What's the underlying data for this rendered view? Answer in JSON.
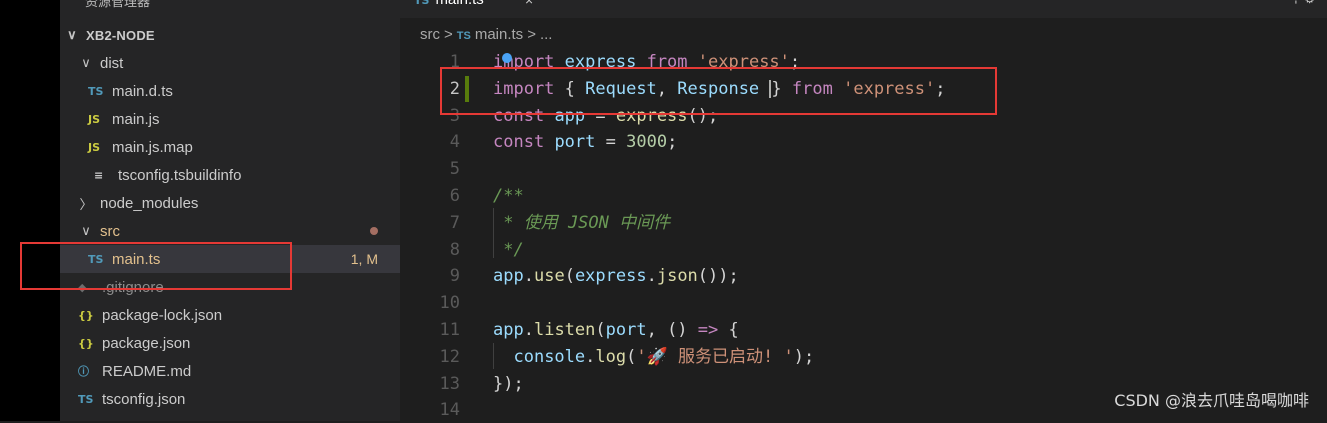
{
  "sidebar": {
    "title": "资源管理器",
    "project": "XB2-NODE",
    "tree": [
      {
        "name": "dist",
        "type": "folder",
        "expanded": true
      },
      {
        "name": "main.d.ts",
        "type": "ts"
      },
      {
        "name": "main.js",
        "type": "js"
      },
      {
        "name": "main.js.map",
        "type": "js"
      },
      {
        "name": "tsconfig.tsbuildinfo",
        "type": "lines"
      },
      {
        "name": "node_modules",
        "type": "folder",
        "expanded": false
      },
      {
        "name": "src",
        "type": "folder",
        "expanded": true
      },
      {
        "name": "main.ts",
        "type": "ts",
        "badge": "1, M"
      },
      {
        "name": ".gitignore",
        "type": "git"
      },
      {
        "name": "package-lock.json",
        "type": "json"
      },
      {
        "name": "package.json",
        "type": "json"
      },
      {
        "name": "README.md",
        "type": "info"
      },
      {
        "name": "tsconfig.json",
        "type": "tsjson"
      }
    ]
  },
  "icons": {
    "ts": "TS",
    "js": "JS",
    "json": "{}",
    "info": "ⓘ",
    "git": "◆",
    "lines": "≡",
    "chevron_down": "∨",
    "chevron_right": "〉"
  },
  "editor": {
    "tab": "main.ts",
    "tab_close": "×",
    "tab_actions": "⊹ ⚙",
    "breadcrumb": [
      "src",
      "main.ts",
      "..."
    ],
    "lines": [
      {
        "n": "1",
        "tokens": [
          [
            "kw",
            "import"
          ],
          [
            "plain",
            " "
          ],
          [
            "var",
            "express"
          ],
          [
            "plain",
            " "
          ],
          [
            "kw",
            "from"
          ],
          [
            "plain",
            " "
          ],
          [
            "str",
            "'express'"
          ],
          [
            "plain",
            ";"
          ]
        ]
      },
      {
        "n": "2",
        "tokens": [
          [
            "kw",
            "import"
          ],
          [
            "plain",
            " { "
          ],
          [
            "var",
            "Request"
          ],
          [
            "plain",
            ", "
          ],
          [
            "var",
            "Response"
          ],
          [
            "plain",
            " "
          ],
          [
            "cursor",
            ""
          ],
          [
            "plain",
            "} "
          ],
          [
            "kw",
            "from"
          ],
          [
            "plain",
            " "
          ],
          [
            "str",
            "'express'"
          ],
          [
            "plain",
            ";"
          ]
        ]
      },
      {
        "n": "3",
        "tokens": [
          [
            "kw",
            "const"
          ],
          [
            "plain",
            " "
          ],
          [
            "var",
            "app"
          ],
          [
            "plain",
            " = "
          ],
          [
            "fn",
            "express"
          ],
          [
            "plain",
            "();"
          ]
        ]
      },
      {
        "n": "4",
        "tokens": [
          [
            "kw",
            "const"
          ],
          [
            "plain",
            " "
          ],
          [
            "var",
            "port"
          ],
          [
            "plain",
            " = "
          ],
          [
            "num",
            "3000"
          ],
          [
            "plain",
            ";"
          ]
        ]
      },
      {
        "n": "5",
        "tokens": []
      },
      {
        "n": "6",
        "tokens": [
          [
            "cmt",
            "/**"
          ]
        ]
      },
      {
        "n": "7",
        "tokens": [
          [
            "cmt",
            " * 使用 JSON 中间件"
          ]
        ]
      },
      {
        "n": "8",
        "tokens": [
          [
            "cmt",
            " */"
          ]
        ]
      },
      {
        "n": "9",
        "tokens": [
          [
            "var",
            "app"
          ],
          [
            "plain",
            "."
          ],
          [
            "fn",
            "use"
          ],
          [
            "plain",
            "("
          ],
          [
            "var",
            "express"
          ],
          [
            "plain",
            "."
          ],
          [
            "fn",
            "json"
          ],
          [
            "plain",
            "());"
          ]
        ]
      },
      {
        "n": "10",
        "tokens": []
      },
      {
        "n": "11",
        "tokens": [
          [
            "var",
            "app"
          ],
          [
            "plain",
            "."
          ],
          [
            "fn",
            "listen"
          ],
          [
            "plain",
            "("
          ],
          [
            "var",
            "port"
          ],
          [
            "plain",
            ", () "
          ],
          [
            "kw",
            "=>"
          ],
          [
            "plain",
            " {"
          ]
        ]
      },
      {
        "n": "12",
        "tokens": [
          [
            "plain",
            "  "
          ],
          [
            "var",
            "console"
          ],
          [
            "plain",
            "."
          ],
          [
            "fn",
            "log"
          ],
          [
            "plain",
            "("
          ],
          [
            "str",
            "'🚀 服务已启动! '"
          ],
          [
            "plain",
            ");"
          ]
        ]
      },
      {
        "n": "13",
        "tokens": [
          [
            "plain",
            "});"
          ]
        ]
      },
      {
        "n": "14",
        "tokens": []
      }
    ]
  },
  "watermark": "CSDN @浪去爪哇岛喝咖啡",
  "colors": {
    "highlight_box": "#e53935",
    "keyword": "#c586c0",
    "variable": "#9cdcfe",
    "string": "#ce9178",
    "number": "#b5cea8",
    "function": "#dcdcaa",
    "comment": "#6a9955"
  }
}
